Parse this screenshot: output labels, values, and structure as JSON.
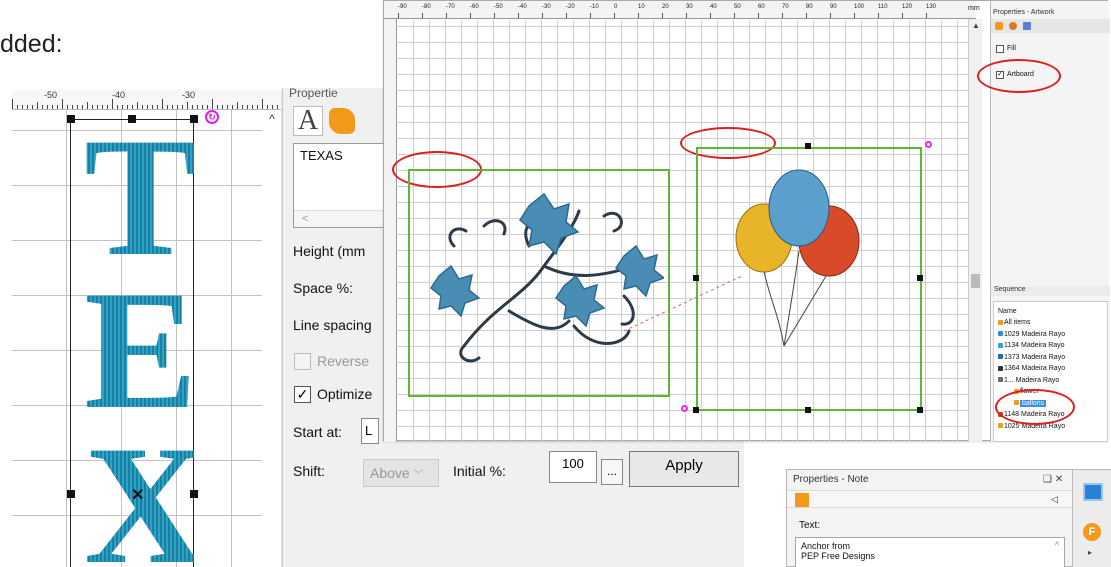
{
  "heading": "dded:",
  "left_panel": {
    "ruler_numbers": [
      "-50",
      "-40",
      "-30"
    ],
    "letters": [
      "T",
      "E",
      "X"
    ],
    "scroll_up": "^"
  },
  "text_panel": {
    "title": "Propertie",
    "tab_text_icon": "A",
    "text_value": "TEXAS",
    "scroll_left": "<",
    "height_label": "Height (mm",
    "space_label": "Space %:",
    "line_spacing_label": "Line spacing",
    "reverse_label": "Reverse",
    "reverse_checked": false,
    "optimize_label": "Optimize",
    "optimize_checked": true,
    "start_at_label": "Start at:",
    "start_at_value": "L",
    "shift_label": "Shift:",
    "shift_value": "Above",
    "initial_label": "Initial %:",
    "initial_value": "100",
    "dots_label": "...",
    "apply_label": "Apply"
  },
  "artwork": {
    "ruler_numbers": [
      "-90",
      "-80",
      "-70",
      "-60",
      "-50",
      "-40",
      "-30",
      "-20",
      "-10",
      "0",
      "10",
      "20",
      "30",
      "40",
      "50",
      "60",
      "70",
      "80",
      "90",
      "100",
      "110",
      "120",
      "130"
    ],
    "ruler_unit": "mm",
    "sidebar": {
      "title": "Properties - Artwork",
      "fill_label": "Fill",
      "fill_checked": false,
      "artboard_label": "Artboard",
      "artboard_checked": true,
      "sequence_title": "Sequence",
      "name_header": "Name",
      "items": [
        {
          "label": "All items",
          "color": "#f39a1a"
        },
        {
          "label": "1029 Madeira Rayo",
          "color": "#2f8fd6"
        },
        {
          "label": "1134 Madeira Rayo",
          "color": "#3a9fd0"
        },
        {
          "label": "1373 Madeira Rayo",
          "color": "#1a6fb0"
        },
        {
          "label": "1364 Madeira Rayo",
          "color": "#333333"
        },
        {
          "label": "1...  Madeira Rayo",
          "color": "#6a6a6a"
        },
        {
          "label": "flower",
          "color": "#f39a1a"
        },
        {
          "label": "ballons",
          "color": "#f39a1a"
        },
        {
          "label": "1148 Madeira Rayo",
          "color": "#d43a2a"
        },
        {
          "label": "1025 Madeira Rayo",
          "color": "#e8a020"
        }
      ]
    }
  },
  "note": {
    "title": "Properties - Note",
    "controls": "❑  ✕",
    "pin": "◁",
    "text_label": "Text:",
    "text_line1": "Anchor from",
    "text_line2": "PEP Free Designs",
    "side_icon_letter": "F",
    "arrow": "▸"
  },
  "colors": {
    "accent_green": "#5cb832",
    "oval_red": "#dc1f1f",
    "thread_blue": "#1f8fb2",
    "orange": "#f39a1a"
  }
}
